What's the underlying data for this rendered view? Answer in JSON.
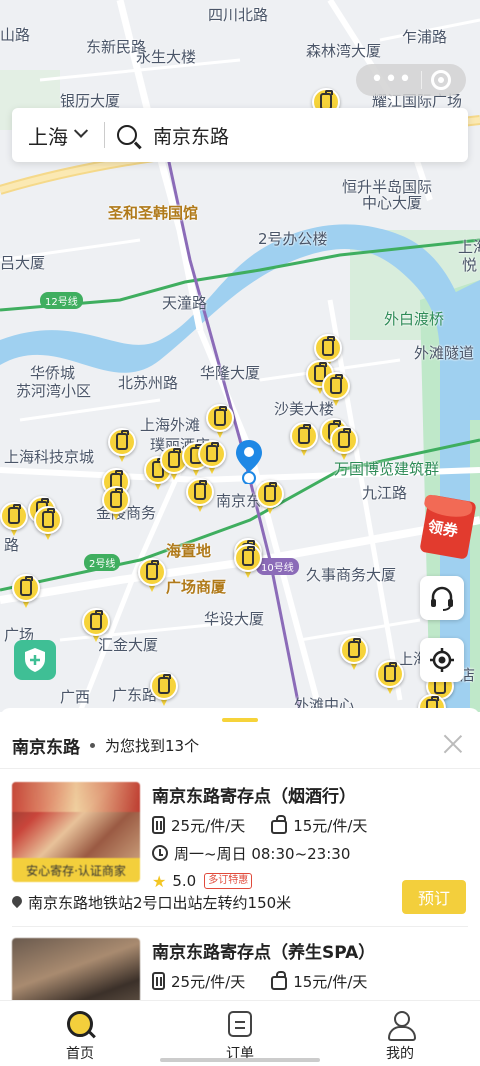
{
  "map": {
    "labels": [
      {
        "text": "四川北路",
        "cls": ""
      },
      {
        "text": "山路",
        "cls": ""
      },
      {
        "text": "东新民路",
        "cls": ""
      },
      {
        "text": "永生大楼",
        "cls": ""
      },
      {
        "text": "森林湾大厦",
        "cls": ""
      },
      {
        "text": "乍浦路",
        "cls": ""
      },
      {
        "text": "银历大厦",
        "cls": ""
      },
      {
        "text": "耀江国际广场",
        "cls": ""
      },
      {
        "text": "恒升半岛国际",
        "cls": ""
      },
      {
        "text": "中心大厦",
        "cls": ""
      },
      {
        "text": "圣和圣韩国馆",
        "cls": "orange"
      },
      {
        "text": "2号办公楼",
        "cls": ""
      },
      {
        "text": "上海",
        "cls": ""
      },
      {
        "text": "悦",
        "cls": ""
      },
      {
        "text": "吕大厦",
        "cls": ""
      },
      {
        "text": "天潼路",
        "cls": ""
      },
      {
        "text": "外白渡桥",
        "cls": "green"
      },
      {
        "text": "华侨城",
        "cls": ""
      },
      {
        "text": "苏河湾小区",
        "cls": ""
      },
      {
        "text": "北苏州路",
        "cls": ""
      },
      {
        "text": "华隆大厦",
        "cls": ""
      },
      {
        "text": "外滩隧道",
        "cls": ""
      },
      {
        "text": "沙美大楼",
        "cls": ""
      },
      {
        "text": "上海外滩",
        "cls": ""
      },
      {
        "text": "璞丽酒店",
        "cls": ""
      },
      {
        "text": "上海科技京城",
        "cls": ""
      },
      {
        "text": "万国博览建筑群",
        "cls": "green"
      },
      {
        "text": "南京东",
        "cls": ""
      },
      {
        "text": "九江路",
        "cls": ""
      },
      {
        "text": "金陵商务",
        "cls": ""
      },
      {
        "text": "海置地",
        "cls": "orange"
      },
      {
        "text": "广场商厦",
        "cls": "orange"
      },
      {
        "text": "久事商务大厦",
        "cls": ""
      },
      {
        "text": "华设大厦",
        "cls": ""
      },
      {
        "text": "广场",
        "cls": ""
      },
      {
        "text": "汇金大厦",
        "cls": ""
      },
      {
        "text": "上海",
        "cls": ""
      },
      {
        "text": "店",
        "cls": ""
      },
      {
        "text": "外滩中心",
        "cls": ""
      },
      {
        "text": "广东路",
        "cls": ""
      },
      {
        "text": "广西",
        "cls": ""
      },
      {
        "text": "路",
        "cls": ""
      }
    ],
    "metro_tags": [
      {
        "text": "12号线",
        "cls": ""
      },
      {
        "text": "2号线",
        "cls": ""
      },
      {
        "text": "10号线",
        "cls": "purple"
      }
    ],
    "locker_pin_count": 30,
    "accent_color": "#f6d33a",
    "water_color": "#9fd0f0",
    "green_color": "#bfe8c9"
  },
  "search": {
    "city": "上海",
    "keyword": "南京东路"
  },
  "coupon": {
    "label": "领券"
  },
  "sheet": {
    "keyword": "南京东路",
    "result_text": "为您找到13个",
    "stores": [
      {
        "name": "南京东路寄存点（烟酒行）",
        "price_small": "25元/件/天",
        "price_large": "15元/件/天",
        "hours": "周一~周日 08:30~23:30",
        "rating": "5.0",
        "promo": "多订特惠",
        "badge": "安心寄存·认证商家",
        "address": "南京东路地铁站2号口出站左转约150米",
        "order_label": "预订"
      },
      {
        "name": "南京东路寄存点（养生SPA）",
        "price_small": "25元/件/天",
        "price_large": "15元/件/天"
      }
    ]
  },
  "tabbar": {
    "home": "首页",
    "orders": "订单",
    "me": "我的"
  }
}
